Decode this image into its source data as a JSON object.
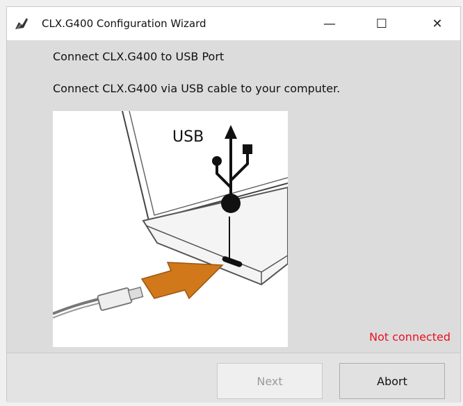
{
  "window": {
    "title": "CLX.G400 Configuration Wizard",
    "controls": {
      "minimize": "—",
      "maximize": "☐",
      "close": "✕"
    }
  },
  "page": {
    "heading": "Connect CLX.G400 to USB Port",
    "instruction": "Connect CLX.G400 via USB cable to  your computer.",
    "illustration": {
      "usb_label": "USB"
    },
    "status": "Not connected",
    "status_color": "#e81123"
  },
  "buttons": {
    "next": "Next",
    "abort": "Abort"
  }
}
